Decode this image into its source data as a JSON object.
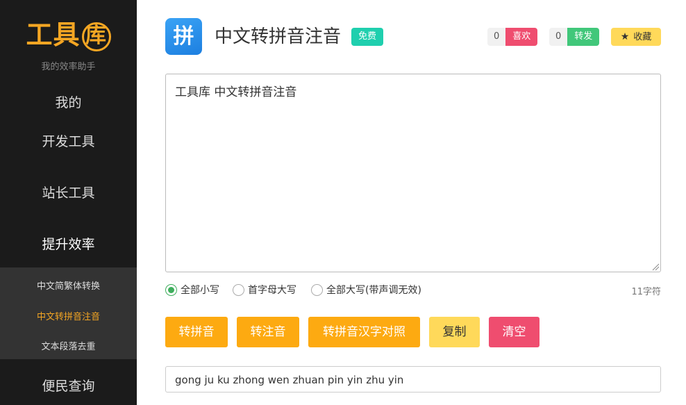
{
  "sidebar": {
    "logo_text": "工具",
    "logo_circle": "库",
    "slogan": "我的效率助手",
    "nav": [
      {
        "label": "我的"
      },
      {
        "label": "开发工具"
      },
      {
        "label": "站长工具"
      },
      {
        "label": "提升效率"
      },
      {
        "label": "便民查询"
      }
    ],
    "subnav": [
      {
        "label": "中文简繁体转换"
      },
      {
        "label": "中文转拼音注音"
      },
      {
        "label": "文本段落去重"
      }
    ]
  },
  "header": {
    "icon_glyph": "拼",
    "title": "中文转拼音注音",
    "badge": "免费",
    "like": {
      "count": "0",
      "label": "喜欢"
    },
    "share": {
      "count": "0",
      "label": "转发"
    },
    "favorite": {
      "label": "收藏",
      "icon": "star-icon"
    }
  },
  "input": {
    "value": "工具库 中文转拼音注音"
  },
  "options": {
    "radios": [
      {
        "label": "全部小写",
        "checked": true
      },
      {
        "label": "首字母大写",
        "checked": false
      },
      {
        "label": "全部大写(带声调无效)",
        "checked": false
      }
    ],
    "char_count": "11字符"
  },
  "buttons": {
    "to_pinyin": "转拼音",
    "to_zhuyin": "转注音",
    "pinyin_compare": "转拼音汉字对照",
    "copy": "复制",
    "clear": "清空"
  },
  "output": {
    "value": "gong ju ku zhong wen zhuan pin yin zhu yin"
  },
  "colors": {
    "accent": "#f5a623",
    "orange_button": "#fdaa11",
    "yellow_button": "#ffd95a",
    "red_button": "#ef4d6f",
    "green": "#41c77a",
    "teal_badge": "#1fcfae"
  }
}
